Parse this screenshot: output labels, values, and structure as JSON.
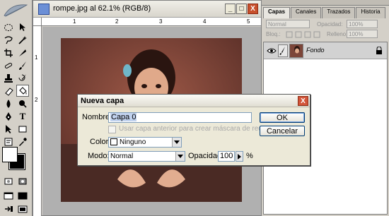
{
  "document": {
    "title": "rompe.jpg al 62.1% (RGB/8)",
    "ruler_top_ticks": [
      "1",
      "2",
      "3",
      "4",
      "5"
    ],
    "ruler_left_ticks": [
      "1",
      "2"
    ]
  },
  "layers_panel": {
    "tabs": [
      "Capas",
      "Canales",
      "Trazados",
      "Historia"
    ],
    "active_tab": "Capas",
    "blend_mode": "Normal",
    "opacity_label": "Opacidad:",
    "opacity_value": "100%",
    "lock_label": "Bloq.:",
    "fill_label": "Relleno:",
    "fill_value": "100%",
    "layer_name": "Fondo"
  },
  "dialog": {
    "title": "Nueva capa",
    "close_glyph": "X",
    "name_label": "Nombre:",
    "name_value": "Capa 0",
    "clip_checkbox_label": "Usar capa anterior para crear máscara de recorte",
    "color_label": "Color:",
    "color_value": "Ninguno",
    "mode_label": "Modo:",
    "mode_value": "Normal",
    "opacity_label": "Opacidad:",
    "opacity_value": "100",
    "opacity_unit": "%",
    "ok_label": "OK",
    "cancel_label": "Cancelar"
  },
  "window_buttons": {
    "minimize": "_",
    "maximize": "□",
    "close": "X"
  },
  "colors": {
    "dialog_bg": "#ece9d8",
    "panel_bg": "#d4d0c8",
    "canvas_bg": "#b0b0b0",
    "close_red": "#c8502c",
    "accent_blue": "#003c74"
  },
  "toolbox": {
    "text_tool_glyph": "T"
  }
}
